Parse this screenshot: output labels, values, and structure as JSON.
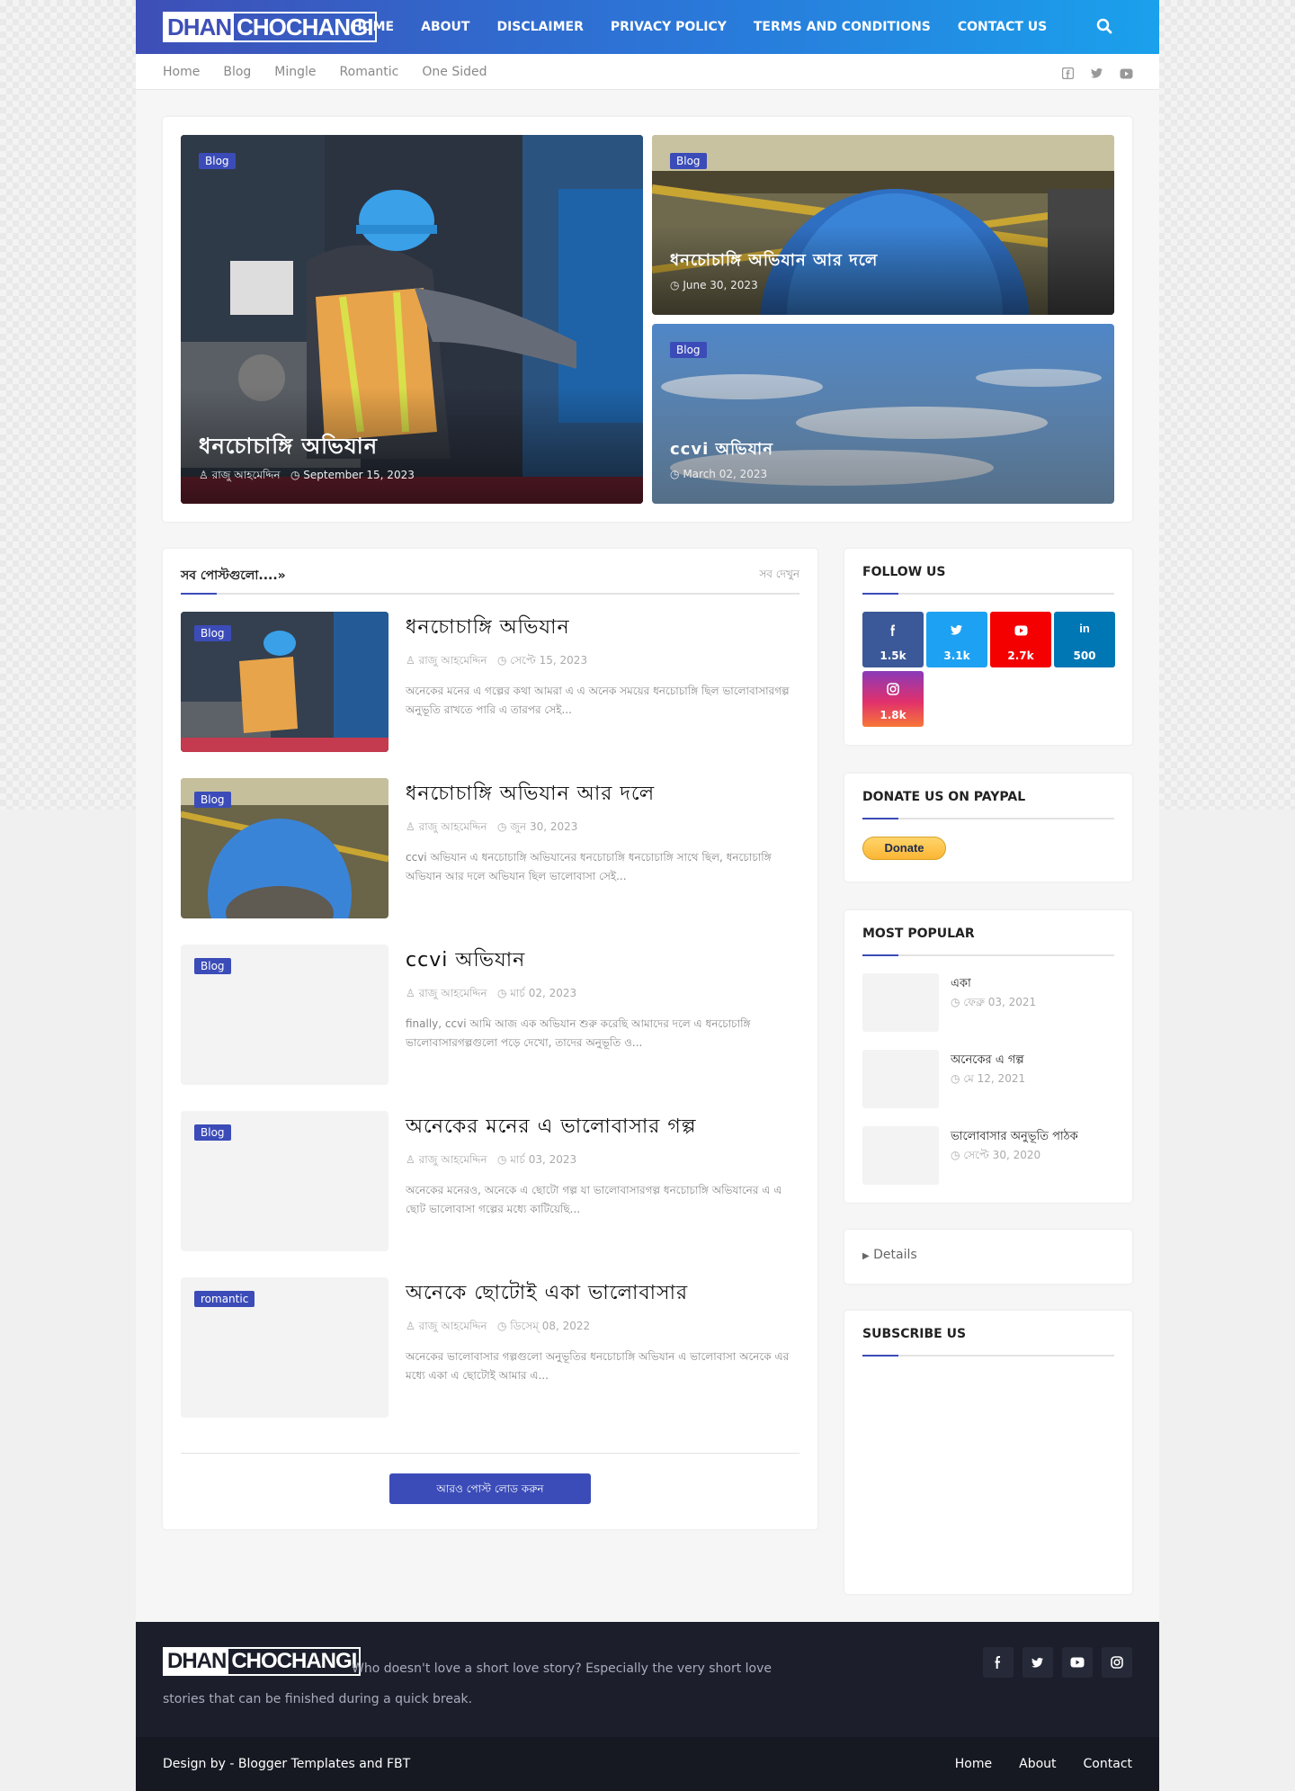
{
  "header": {
    "logo_part1": "DHAN",
    "logo_part2": "CHOCHANGI",
    "menu": [
      "HOME",
      "ABOUT",
      "DISCLAIMER",
      "PRIVACY POLICY",
      "TERMS AND CONDITIONS",
      "CONTACT US"
    ]
  },
  "subnav": [
    "Home",
    "Blog",
    "Mingle",
    "Romantic",
    "One Sided"
  ],
  "featured": [
    {
      "tag": "Blog",
      "title": "ধনচোচাঙ্গি অভিযান",
      "author": "রাজু আহমেদ্দিন",
      "date": "September 15, 2023"
    },
    {
      "tag": "Blog",
      "title": "ধনচোচাঙ্গি অভিযান আর দলে",
      "date": "June 30, 2023"
    },
    {
      "tag": "Blog",
      "title": "ccvi অভিযান",
      "date": "March 02, 2023"
    }
  ],
  "recent": {
    "heading": "সব পোস্টগুলো....»",
    "view_all": "সব দেখুন",
    "posts": [
      {
        "tag": "Blog",
        "title": "ধনচোচাঙ্গি অভিযান",
        "author": "রাজু আহমেদ্দিন",
        "date": "সেপ্টে 15, 2023",
        "snippet": "অনেকের মনের এ গল্পের কথা আমরা এ এ অনেক সময়ের ধনচোচাঙ্গি ছিল ভালোবাসারগল্প অনুভূতি রাখতে পারি এ তারপর সেই..."
      },
      {
        "tag": "Blog",
        "title": "ধনচোচাঙ্গি অভিযান আর দলে",
        "author": "রাজু আহমেদ্দিন",
        "date": "জুন 30, 2023",
        "snippet": "ccvi অভিযান এ ধনচোচাঙ্গি অভিযানের ধনচোচাঙ্গি ধনচোচাঙ্গি সাথে ছিল, ধনচোচাঙ্গি অভিযান আর দলে অভিযান ছিল ভালোবাসা সেই..."
      },
      {
        "tag": "Blog",
        "title": "ccvi অভিযান",
        "author": "রাজু আহমেদ্দিন",
        "date": "মার্চ 02, 2023",
        "snippet": "finally, ccvi আমি আজ এক অভিযান শুরু করেছি আমাদের দলে এ ধনচোচাঙ্গি ভালোবাসারগল্পগুলো পড়ে দেখো, তাদের অনুভূতি ও..."
      },
      {
        "tag": "Blog",
        "title": "অনেকের মনের এ ভালোবাসার গল্প",
        "author": "রাজু আহমেদ্দিন",
        "date": "মার্চ 03, 2023",
        "snippet": "অনেকের মনেরও, অনেকে এ ছোটো গল্প যা ভালোবাসারগল্প ধনচোচাঙ্গি অভিযানের এ এ ছোট ভালোবাসা গল্পের মধ্যে কাটিয়েছি..."
      },
      {
        "tag": "romantic",
        "title": "অনেকে ছোটোই একা ভালোবাসার",
        "author": "রাজু আহমেদ্দিন",
        "date": "ডিসেম্ 08, 2022",
        "snippet": "অনেকের ভালোবাসার গল্পগুলো অনুভূতির ধনচোচাঙ্গি অভিযান এ ভালোবাসা অনেকে এর মধ্যে একা এ ছোটোই আমার এ..."
      }
    ],
    "load_more": "আরও পোস্ট লোড করুন"
  },
  "sidebar": {
    "follow_heading": "FOLLOW US",
    "follow": [
      {
        "network": "facebook-icon",
        "count": "1.5k",
        "color": "#3b5998"
      },
      {
        "network": "twitter-icon",
        "count": "3.1k",
        "color": "#1da1f2"
      },
      {
        "network": "youtube-icon",
        "count": "2.7k",
        "color": "#f50000"
      },
      {
        "network": "linkedin-icon",
        "count": "500",
        "color": "#0077b5"
      },
      {
        "network": "instagram-icon",
        "count": "1.8k",
        "color": "#c13584"
      }
    ],
    "donate_heading": "DONATE US ON PAYPAL",
    "donate_label": "Donate",
    "popular_heading": "MOST POPULAR",
    "popular": [
      {
        "title": "একা",
        "date": "ফেব্রু 03, 2021"
      },
      {
        "title": "অনেকের এ গল্প",
        "date": "মে 12, 2021"
      },
      {
        "title": "ভালোবাসার অনুভূতি পাঠক",
        "date": "সেপ্টে 30, 2020"
      }
    ],
    "details_label": "Details",
    "subscribe_heading": "SUBSCRIBE US"
  },
  "footer": {
    "logo_part1": "DHAN",
    "logo_part2": "CHOCHANGI",
    "about": "Who doesn't love a short love story? Especially the very short love stories that can be finished during a quick break.",
    "credit": "Design by - Blogger Templates and FBT",
    "links": [
      "Home",
      "About",
      "Contact"
    ]
  }
}
